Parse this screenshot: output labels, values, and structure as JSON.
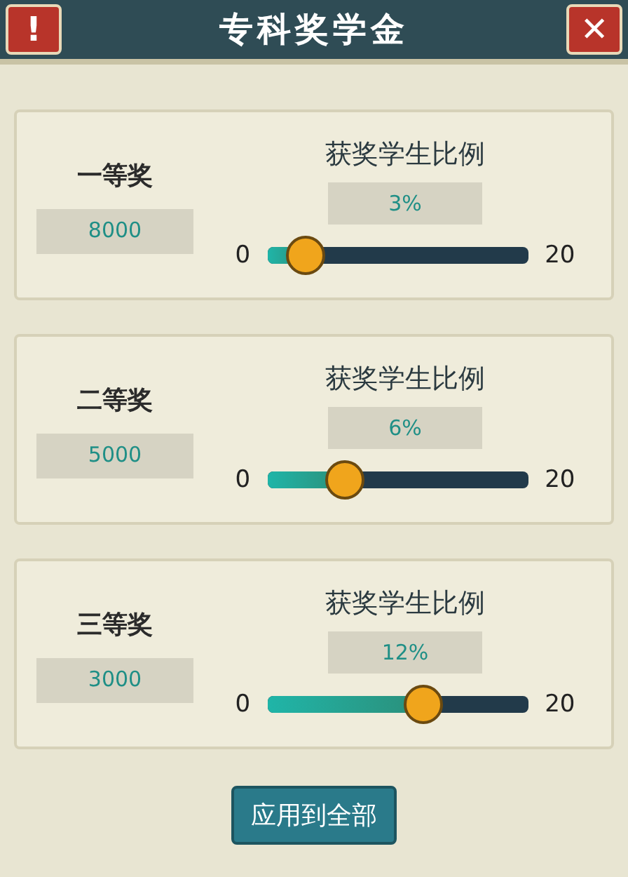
{
  "header": {
    "title": "专科奖学金",
    "alert_button": "!",
    "close_button": "✕"
  },
  "prizes": [
    {
      "name": "一等奖",
      "amount": "8000",
      "ratio_label": "获奖学生比例",
      "ratio": "3%",
      "min": "0",
      "max": "20",
      "level": 0.15
    },
    {
      "name": "二等奖",
      "amount": "5000",
      "ratio_label": "获奖学生比例",
      "ratio": "6%",
      "min": "0",
      "max": "20",
      "level": 0.3
    },
    {
      "name": "三等奖",
      "amount": "3000",
      "ratio_label": "获奖学生比例",
      "ratio": "12%",
      "min": "0",
      "max": "20",
      "level": 0.6
    }
  ],
  "apply_button": "应用到全部"
}
